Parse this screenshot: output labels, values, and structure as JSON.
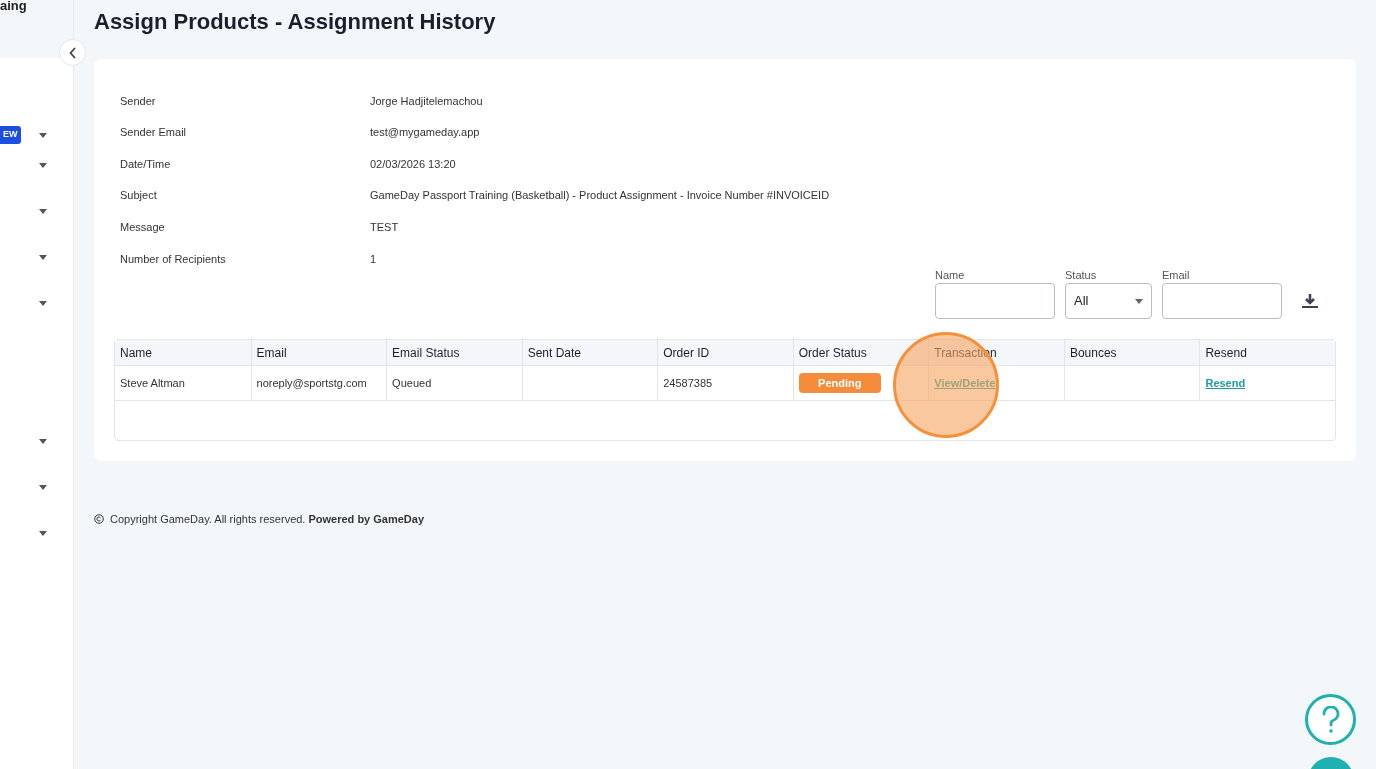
{
  "sidebar": {
    "title": "aing",
    "items": [
      {
        "kind": "badge",
        "badge": "EW"
      },
      {
        "kind": "plain"
      },
      {
        "kind": "plain"
      },
      {
        "kind": "plain"
      },
      {
        "kind": "plain"
      },
      {
        "kind": "gap"
      },
      {
        "kind": "plain"
      },
      {
        "kind": "plain"
      },
      {
        "kind": "plain"
      }
    ]
  },
  "page": {
    "title": "Assign Products - Assignment History"
  },
  "details": [
    {
      "label": "Sender",
      "value": "Jorge Hadjitelemachou"
    },
    {
      "label": "Sender Email",
      "value": "test@mygameday.app"
    },
    {
      "label": "Date/Time",
      "value": "02/03/2026 13:20"
    },
    {
      "label": "Subject",
      "value": "GameDay Passport Training (Basketball) - Product Assignment - Invoice Number #INVOICEID"
    },
    {
      "label": "Message",
      "value": "TEST"
    },
    {
      "label": "Number of Recipients",
      "value": "1"
    }
  ],
  "filters": {
    "name": {
      "label": "Name"
    },
    "status": {
      "label": "Status",
      "value": "All"
    },
    "email": {
      "label": "Email"
    }
  },
  "table": {
    "columns": [
      "Name",
      "Email",
      "Email Status",
      "Sent Date",
      "Order ID",
      "Order Status",
      "Transaction",
      "Bounces",
      "Resend"
    ],
    "rows": [
      {
        "cells": [
          {
            "kind": "text",
            "text": "Steve Altman"
          },
          {
            "kind": "text",
            "text": "noreply@sportstg.com"
          },
          {
            "kind": "text",
            "text": "Queued"
          },
          {
            "kind": "empty"
          },
          {
            "kind": "text",
            "text": "24587385"
          },
          {
            "kind": "status",
            "text": "Pending"
          },
          {
            "kind": "link",
            "text": "View/Delete"
          },
          {
            "kind": "empty"
          },
          {
            "kind": "link",
            "text": "Resend"
          }
        ]
      }
    ]
  },
  "footer": "Copyright GameDay. All rights reserved. **Powered by GameDay**",
  "click_highlight": true
}
